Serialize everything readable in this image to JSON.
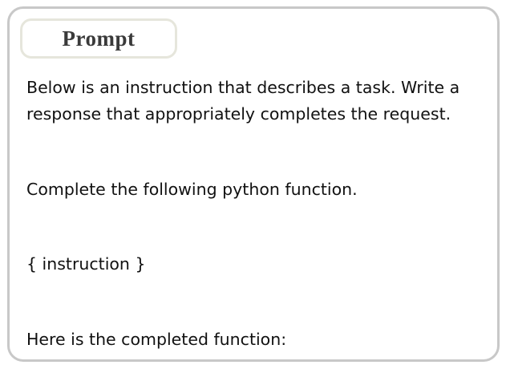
{
  "card": {
    "title": "Prompt",
    "paragraphs": [
      "Below is an instruction that describes a task. Write a",
      "response that appropriately completes the request.",
      "Complete the following python function.",
      "{ instruction }",
      "Here is the completed function:"
    ]
  }
}
